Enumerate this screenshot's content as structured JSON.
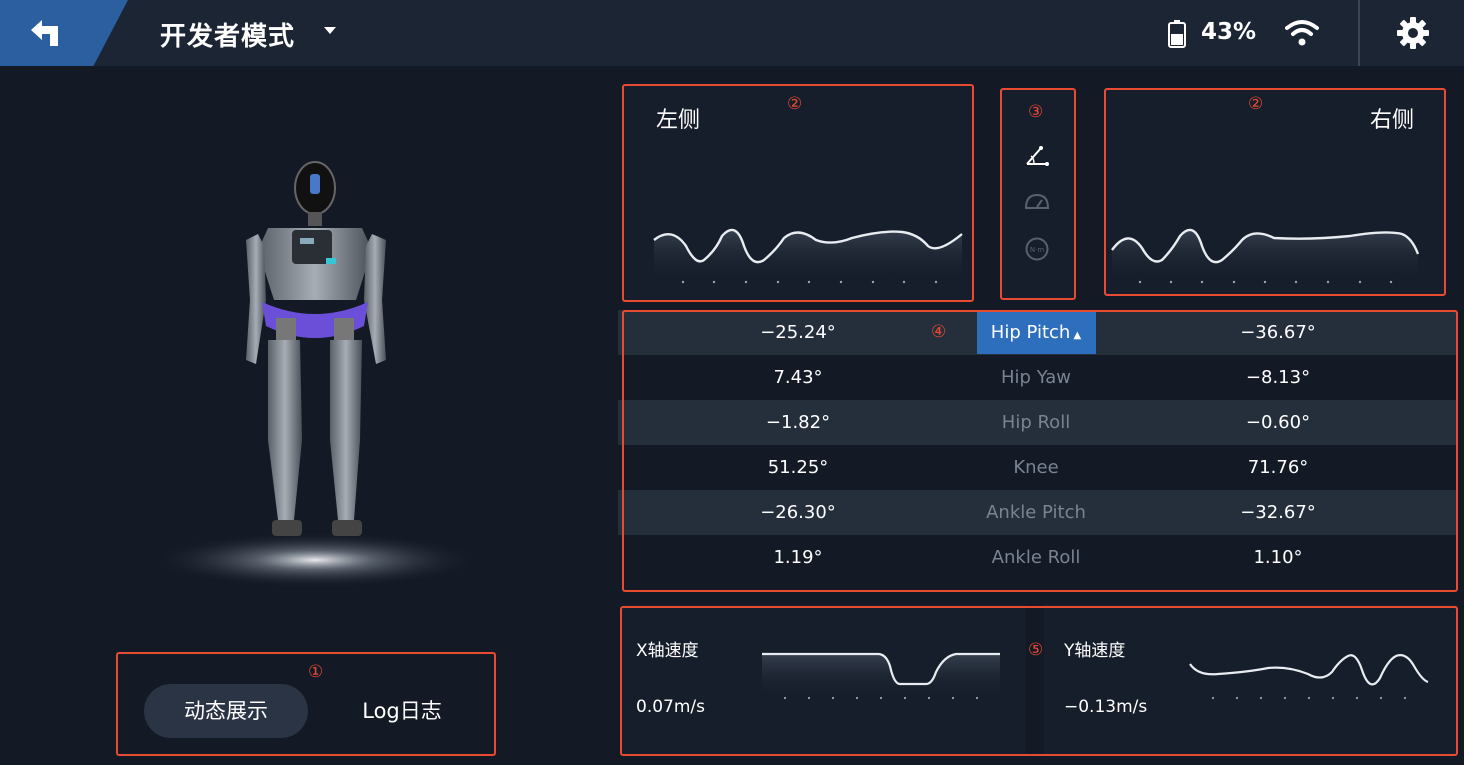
{
  "header": {
    "title": "开发者模式",
    "battery_percent": "43%",
    "battery_level": 0.43
  },
  "badges": {
    "b1": "①",
    "b2": "②",
    "b3": "③",
    "b4": "④",
    "b5": "⑤"
  },
  "mode": {
    "dynamic_label": "动态展示",
    "log_label": "Log日志"
  },
  "sides": {
    "left": "左侧",
    "right": "右侧"
  },
  "joints": [
    {
      "left": "−25.24°",
      "name": "Hip Pitch",
      "right": "−36.67°",
      "active": true
    },
    {
      "left": "7.43°",
      "name": "Hip Yaw",
      "right": "−8.13°"
    },
    {
      "left": "−1.82°",
      "name": "Hip Roll",
      "right": "−0.60°"
    },
    {
      "left": "51.25°",
      "name": "Knee",
      "right": "71.76°"
    },
    {
      "left": "−26.30°",
      "name": "Ankle Pitch",
      "right": "−32.67°"
    },
    {
      "left": "1.19°",
      "name": "Ankle Roll",
      "right": "1.10°"
    }
  ],
  "speed": {
    "x_label": "X轴速度",
    "x_value": "0.07m/s",
    "y_label": "Y轴速度",
    "y_value": "−0.13m/s"
  },
  "icons": {
    "back": "back-arrow-icon",
    "dropdown": "chevron-down-icon",
    "battery": "battery-icon",
    "wifi": "wifi-icon",
    "settings": "gear-icon",
    "angle": "angle-icon",
    "speed": "speedometer-icon",
    "torque": "torque-icon"
  },
  "colors": {
    "accent": "#2e6fbd",
    "annotation": "#e84a32",
    "background": "#131a26"
  }
}
